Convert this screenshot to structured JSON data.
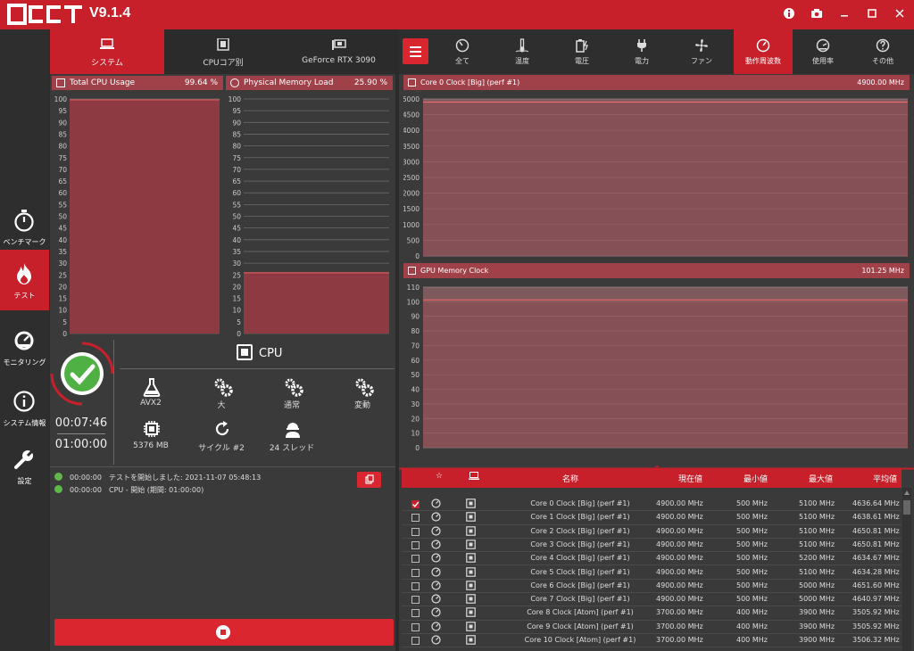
{
  "app": {
    "version": "V9.1.4",
    "accent": "#c8202a"
  },
  "sidebar": {
    "items": [
      {
        "label": "ベンチマーク",
        "icon": "stopwatch-icon"
      },
      {
        "label": "テスト",
        "icon": "flame-icon"
      },
      {
        "label": "モニタリング",
        "icon": "gauge-icon"
      },
      {
        "label": "システム情報",
        "icon": "info-icon"
      },
      {
        "label": "設定",
        "icon": "wrench-icon"
      }
    ]
  },
  "left_tabs": [
    {
      "label": "システム",
      "icon": "laptop-icon"
    },
    {
      "label": "CPUコア別",
      "icon": "cpu-icon"
    },
    {
      "label": "GeForce RTX 3090",
      "icon": "gpu-icon"
    }
  ],
  "cpu_usage": {
    "title": "Total CPU Usage",
    "value": "99.64 %",
    "fraction": 0.9964
  },
  "memory_load": {
    "title": "Physical Memory Load",
    "value": "25.90 %",
    "fraction": 0.259
  },
  "percent_ticks": [
    "100",
    "95",
    "90",
    "85",
    "80",
    "75",
    "70",
    "65",
    "60",
    "55",
    "50",
    "45",
    "40",
    "35",
    "30",
    "25",
    "20",
    "15",
    "10",
    "5",
    "0"
  ],
  "test": {
    "elapsed": "00:07:46",
    "duration": "01:00:00",
    "cpu_label": "CPU",
    "items": [
      {
        "label": "AVX2",
        "icon": "flask-icon"
      },
      {
        "label": "大",
        "icon": "gears-icon"
      },
      {
        "label": "通常",
        "icon": "gears-icon"
      },
      {
        "label": "変動",
        "icon": "gears-icon"
      },
      {
        "label": "5376 MB",
        "icon": "chip-icon"
      },
      {
        "label": "サイクル #2",
        "icon": "refresh-icon"
      },
      {
        "label": "24 スレッド",
        "icon": "worker-icon"
      }
    ]
  },
  "log": [
    {
      "time": "00:00:00",
      "text": "テストを開始しました: 2021-11-07 05:48:13"
    },
    {
      "time": "00:00:00",
      "text": "CPU - 開始 (期間: 01:00:00)"
    }
  ],
  "right_tabs": [
    {
      "label": "全て",
      "icon": "dashboard-icon"
    },
    {
      "label": "温度",
      "icon": "thermometer-icon"
    },
    {
      "label": "電圧",
      "icon": "battery-icon"
    },
    {
      "label": "電力",
      "icon": "plug-icon"
    },
    {
      "label": "ファン",
      "icon": "fan-icon"
    },
    {
      "label": "動作周波数",
      "icon": "speedometer-icon"
    },
    {
      "label": "使用率",
      "icon": "gauge-icon"
    },
    {
      "label": "その他",
      "icon": "question-icon"
    }
  ],
  "core_clock_chart": {
    "title": "Core 0 Clock [Big] (perf #1)",
    "value": "4900.00 MHz",
    "ticks": [
      "5000",
      "4500",
      "4000",
      "3500",
      "3000",
      "2500",
      "2000",
      "1500",
      "1000",
      "500",
      "0"
    ],
    "ymax": 5000,
    "series_value": 4900
  },
  "gpu_mem_chart": {
    "title": "GPU Memory Clock",
    "value": "101.25 MHz",
    "ticks": [
      "110",
      "100",
      "90",
      "80",
      "70",
      "60",
      "50",
      "40",
      "30",
      "20",
      "10",
      "0"
    ],
    "ymax": 110,
    "series_value": 101.25
  },
  "table": {
    "headers": {
      "name": "名称",
      "current": "現在値",
      "min": "最小値",
      "max": "最大値",
      "avg": "平均値"
    },
    "rows": [
      {
        "checked": true,
        "name": "Core 0 Clock [Big] (perf #1)",
        "current": "4900.00 MHz",
        "min": "500 MHz",
        "max": "5100 MHz",
        "avg": "4636.64 MHz"
      },
      {
        "checked": false,
        "name": "Core 1 Clock [Big] (perf #1)",
        "current": "4900.00 MHz",
        "min": "500 MHz",
        "max": "5100 MHz",
        "avg": "4638.61 MHz"
      },
      {
        "checked": false,
        "name": "Core 2 Clock [Big] (perf #1)",
        "current": "4900.00 MHz",
        "min": "500 MHz",
        "max": "5100 MHz",
        "avg": "4650.81 MHz"
      },
      {
        "checked": false,
        "name": "Core 3 Clock [Big] (perf #1)",
        "current": "4900.00 MHz",
        "min": "500 MHz",
        "max": "5100 MHz",
        "avg": "4650.81 MHz"
      },
      {
        "checked": false,
        "name": "Core 4 Clock [Big] (perf #1)",
        "current": "4900.00 MHz",
        "min": "500 MHz",
        "max": "5200 MHz",
        "avg": "4634.67 MHz"
      },
      {
        "checked": false,
        "name": "Core 5 Clock [Big] (perf #1)",
        "current": "4900.00 MHz",
        "min": "500 MHz",
        "max": "5100 MHz",
        "avg": "4634.28 MHz"
      },
      {
        "checked": false,
        "name": "Core 6 Clock [Big] (perf #1)",
        "current": "4900.00 MHz",
        "min": "500 MHz",
        "max": "5000 MHz",
        "avg": "4651.60 MHz"
      },
      {
        "checked": false,
        "name": "Core 7 Clock [Big] (perf #1)",
        "current": "4900.00 MHz",
        "min": "500 MHz",
        "max": "5000 MHz",
        "avg": "4640.97 MHz"
      },
      {
        "checked": false,
        "name": "Core 8 Clock [Atom] (perf #1)",
        "current": "3700.00 MHz",
        "min": "400 MHz",
        "max": "3900 MHz",
        "avg": "3505.92 MHz"
      },
      {
        "checked": false,
        "name": "Core 9 Clock [Atom] (perf #1)",
        "current": "3700.00 MHz",
        "min": "400 MHz",
        "max": "3900 MHz",
        "avg": "3505.92 MHz"
      },
      {
        "checked": false,
        "name": "Core 10 Clock [Atom] (perf #1)",
        "current": "3700.00 MHz",
        "min": "400 MHz",
        "max": "3900 MHz",
        "avg": "3506.32 MHz"
      }
    ]
  }
}
